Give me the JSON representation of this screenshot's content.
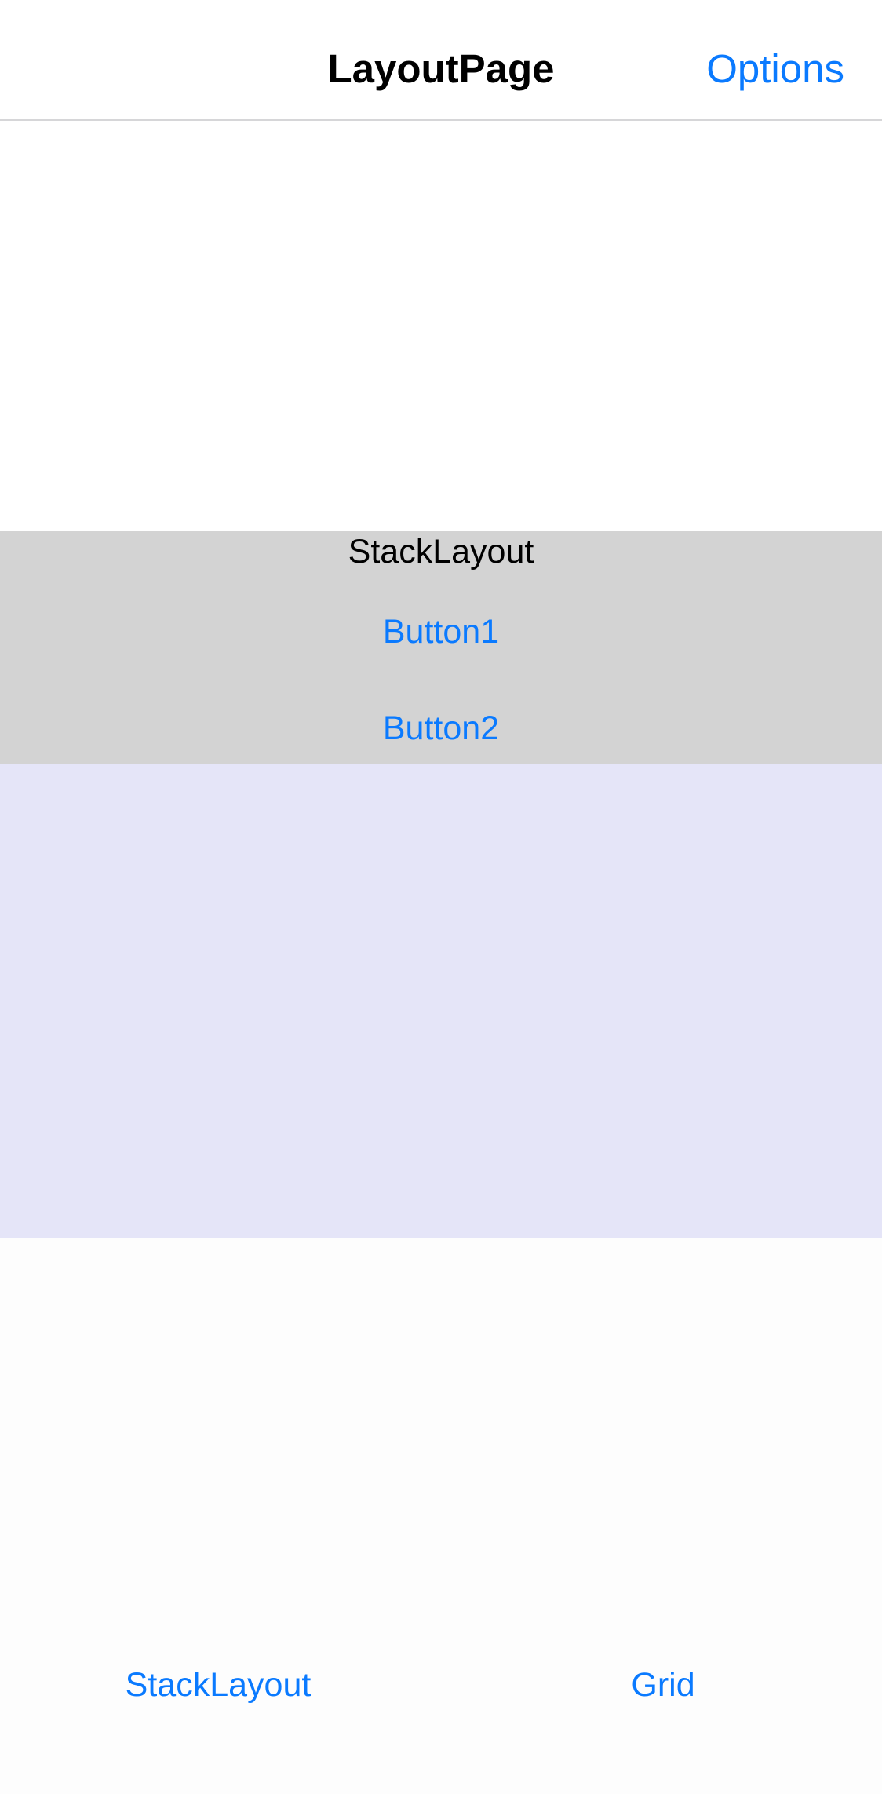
{
  "navbar": {
    "title": "LayoutPage",
    "options_label": "Options"
  },
  "stack": {
    "label": "StackLayout",
    "buttons": [
      "Button1",
      "Button2"
    ]
  },
  "tabs": [
    "StackLayout",
    "Grid"
  ],
  "colors": {
    "accent": "#0a7aff",
    "stack_background": "#d3d3d3",
    "lavender_background": "#e5e5f8"
  }
}
